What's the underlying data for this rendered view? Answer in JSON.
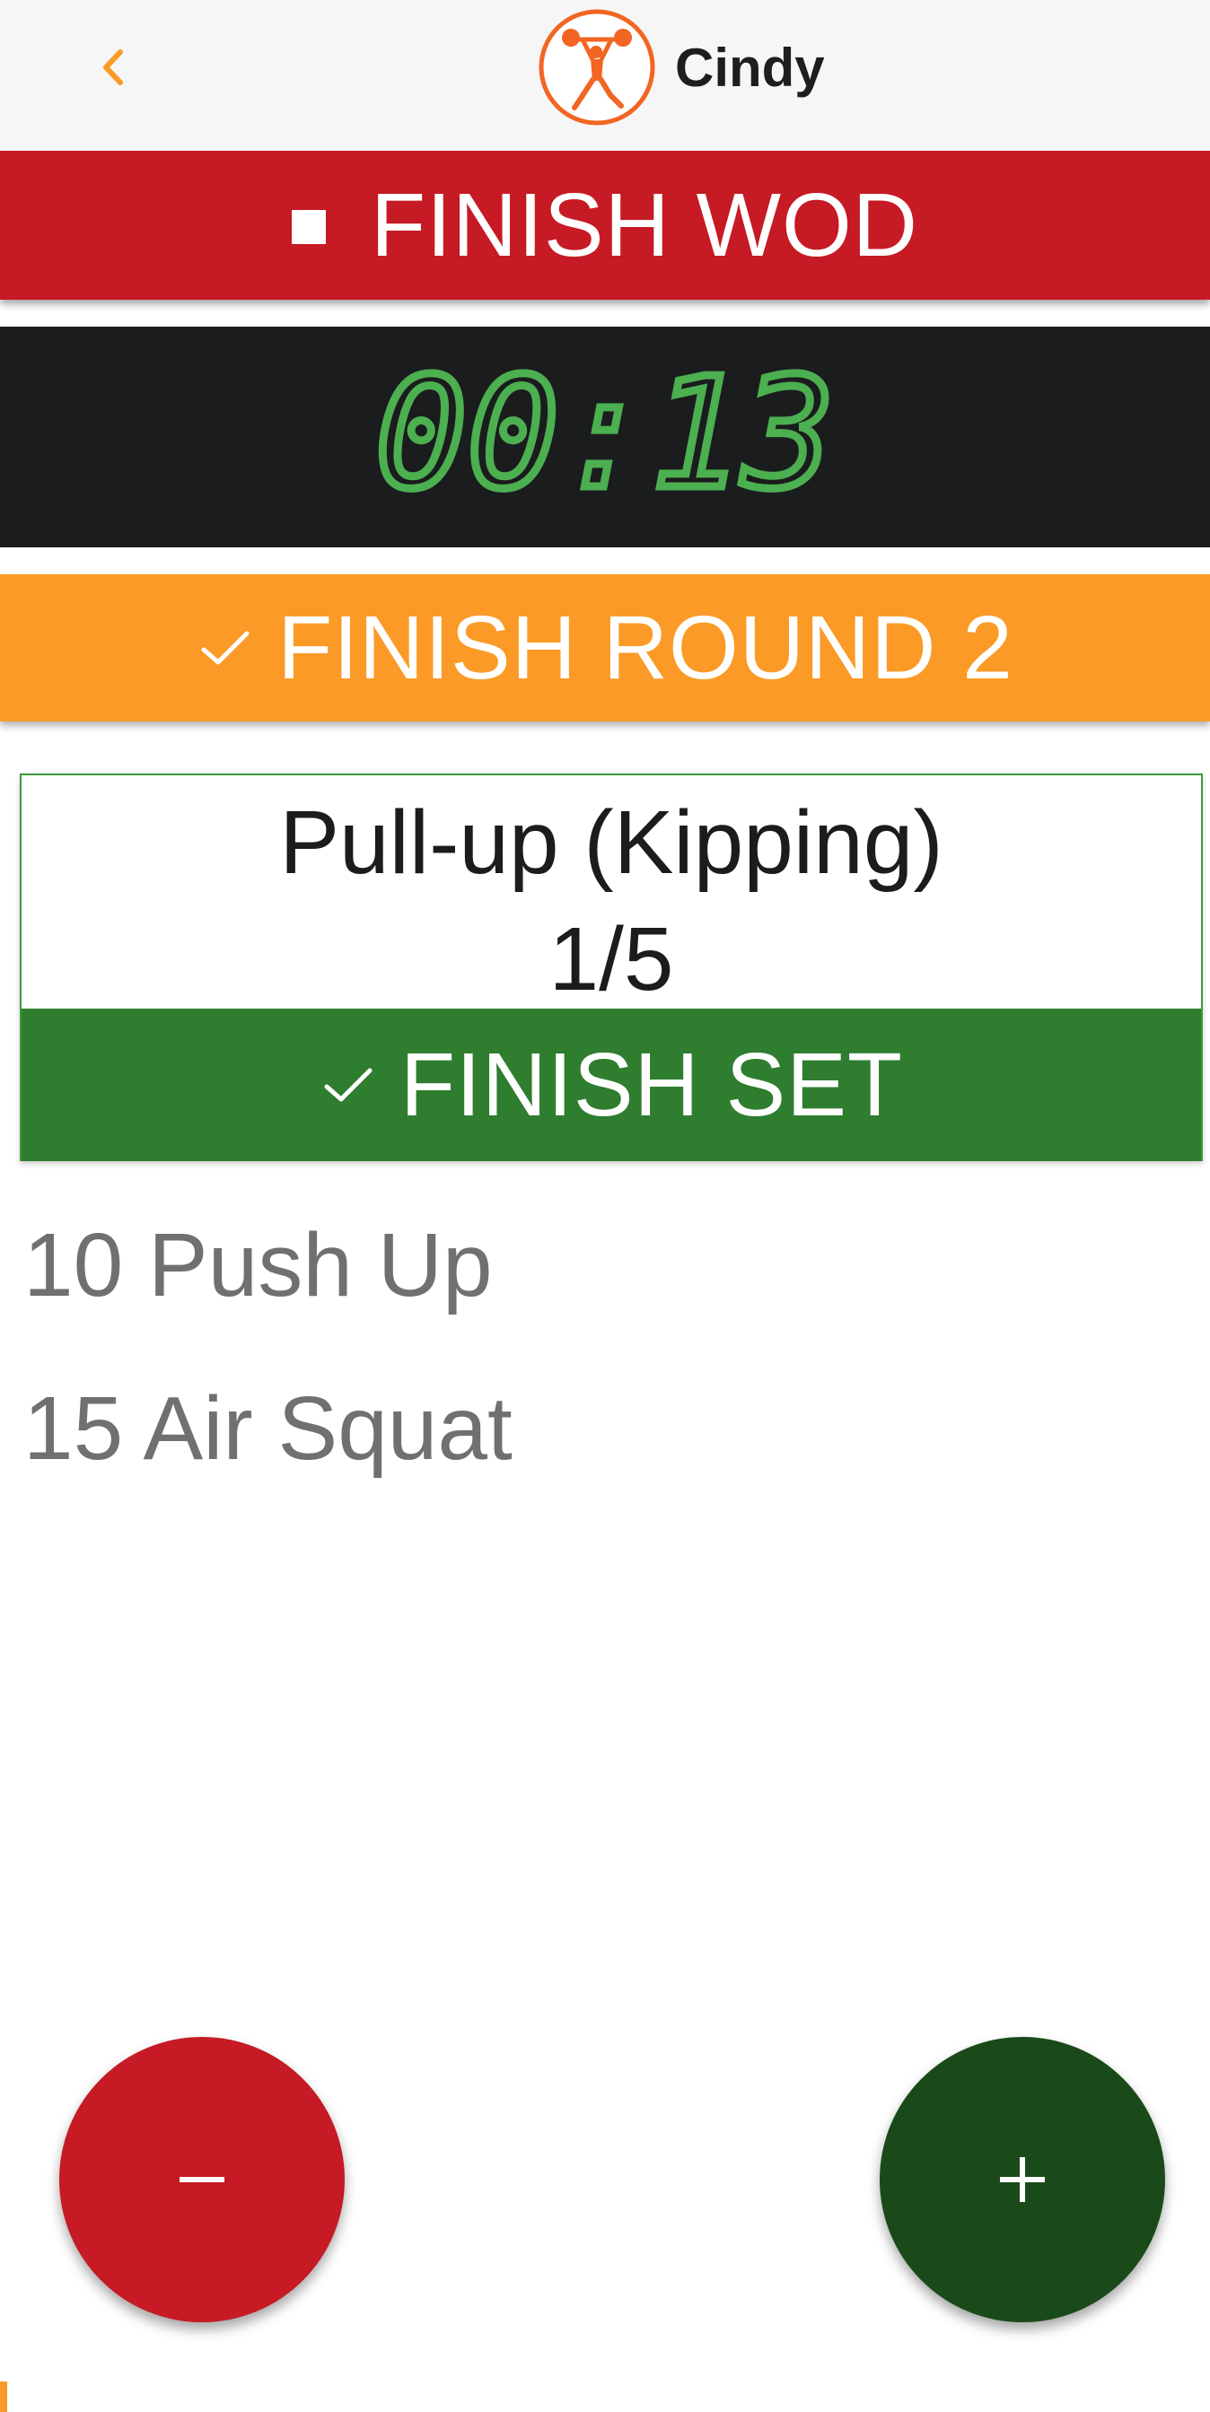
{
  "header": {
    "title": "Cindy",
    "back_icon": "chevron-left-icon",
    "logo_icon": "weightlifter-icon"
  },
  "finish_wod": {
    "label": "FINISH WOD",
    "icon": "stop-icon"
  },
  "timer": {
    "value": "00:13"
  },
  "finish_round": {
    "label": "FINISH ROUND 2",
    "icon": "check-icon"
  },
  "current_exercise": {
    "name": "Pull-up (Kipping)",
    "progress": "1/5",
    "finish_set_label": "FINISH SET",
    "finish_set_icon": "check-icon"
  },
  "upcoming": [
    "10 Push Up",
    "15 Air Squat"
  ],
  "fabs": {
    "minus_icon": "minus-icon",
    "plus_icon": "plus-icon"
  },
  "colors": {
    "accent_orange": "#fb9a26",
    "red": "#c61a24",
    "green": "#2f7d2f",
    "dark_green": "#1a4a19",
    "timer_bg": "#1b1c1e",
    "timer_digits": "#4caf50",
    "logo_orange": "#f26522"
  }
}
